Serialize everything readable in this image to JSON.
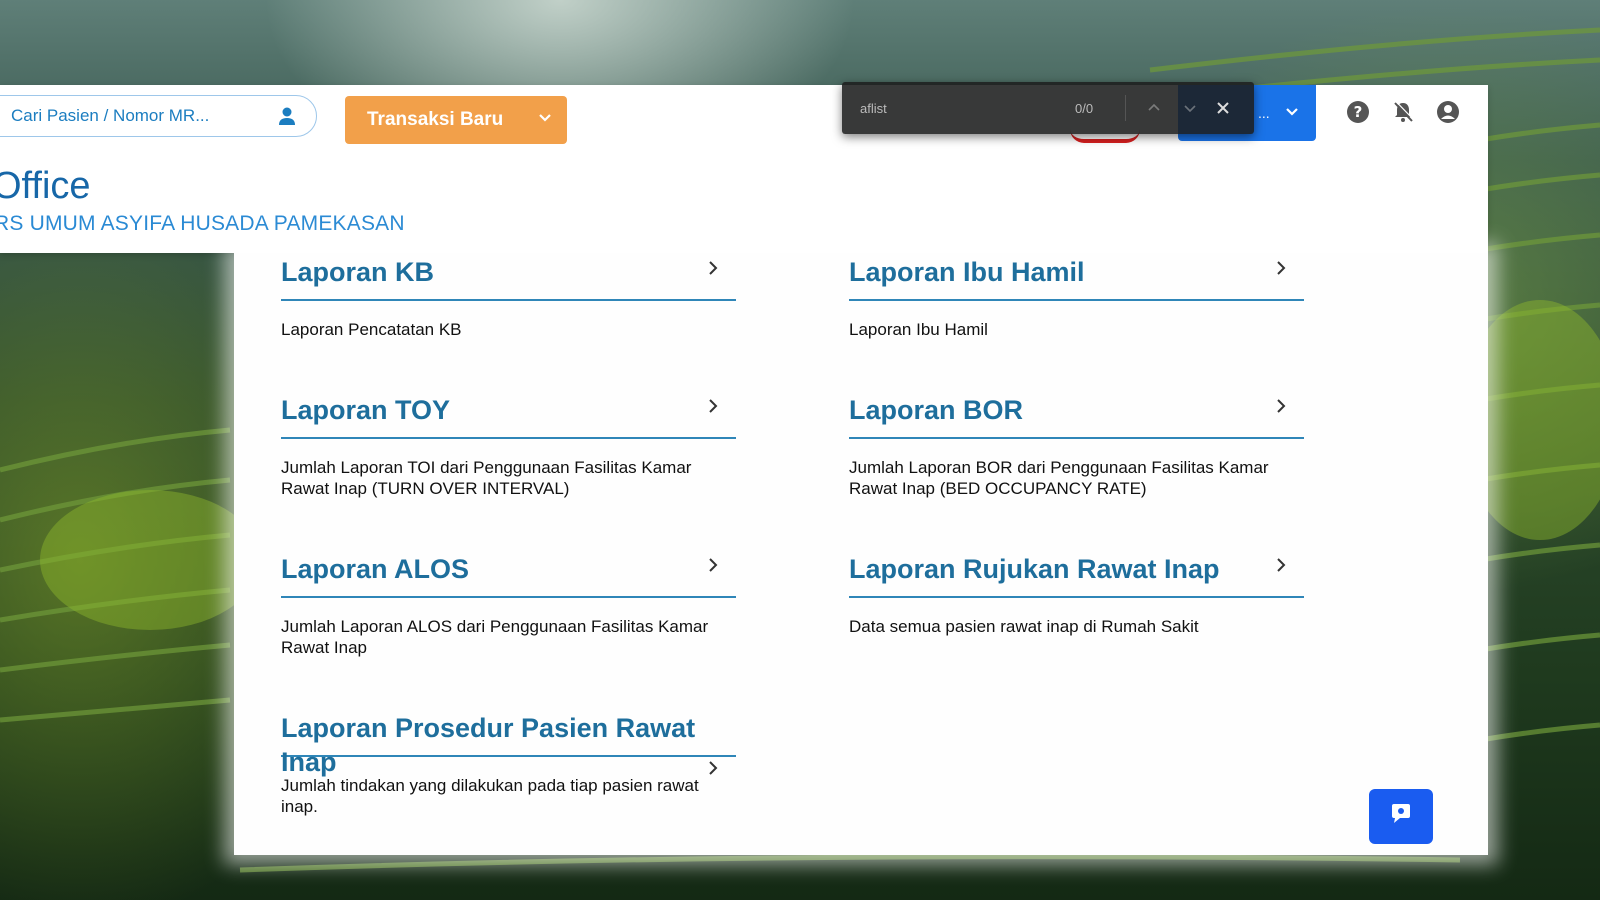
{
  "search": {
    "placeholder": "Cari Pasien / Nomor MR..."
  },
  "toolbar": {
    "transaksi_label": "Transaksi Baru",
    "blue_button_text": "..."
  },
  "header": {
    "title": "Office",
    "subtitle": "RS UMUM ASYIFA HUSADA PAMEKASAN"
  },
  "findbar": {
    "query": "aflist",
    "count": "0/0"
  },
  "cards": [
    {
      "title": "Laporan KB",
      "desc": "Laporan Pencatatan KB"
    },
    {
      "title": "Laporan Ibu Hamil",
      "desc": "Laporan Ibu Hamil"
    },
    {
      "title": "Laporan TOY",
      "desc": "Jumlah Laporan TOI dari Penggunaan Fasilitas Kamar Rawat Inap (TURN OVER INTERVAL)"
    },
    {
      "title": "Laporan BOR",
      "desc": "Jumlah Laporan BOR dari Penggunaan Fasilitas Kamar Rawat Inap (BED OCCUPANCY RATE)"
    },
    {
      "title": "Laporan ALOS",
      "desc": "Jumlah Laporan ALOS dari Penggunaan Fasilitas Kamar Rawat Inap"
    },
    {
      "title": "Laporan Rujukan Rawat Inap",
      "desc": "Data semua pasien rawat inap di Rumah Sakit"
    },
    {
      "title": "Laporan Prosedur Pasien Rawat Inap",
      "desc": "Jumlah tindakan yang dilakukan pada tiap pasien rawat inap."
    }
  ],
  "colors": {
    "accent": "#1e6e9c",
    "orange": "#f2a04a",
    "blue": "#1a73e8"
  }
}
